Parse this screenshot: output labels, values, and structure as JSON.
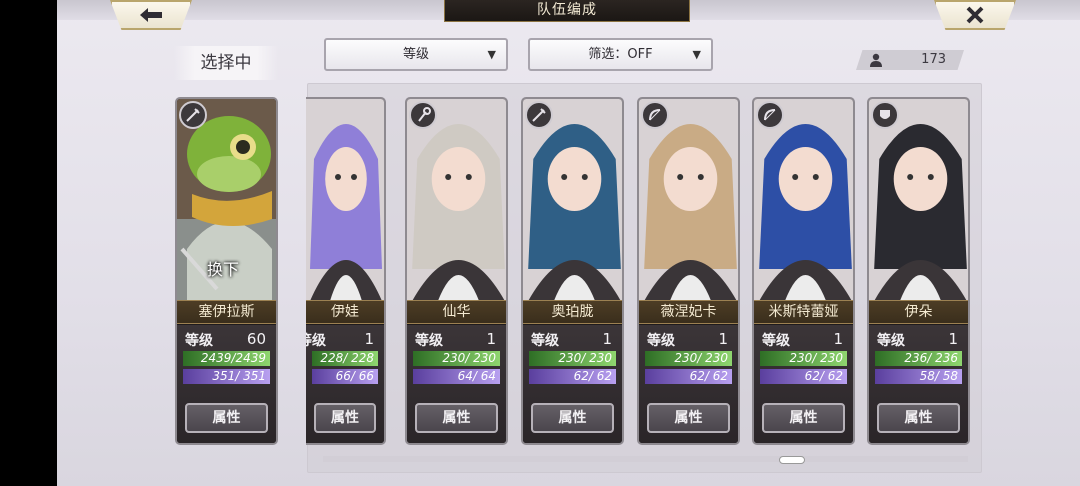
{
  "header": {
    "title": "队伍编成",
    "back_icon": "back-arrow-icon",
    "close_icon": "close-x-icon"
  },
  "selecting_label": "选择中",
  "filters": {
    "sort": {
      "value": "等级",
      "icon": "triangle-down-icon"
    },
    "filter": {
      "value": "筛选：OFF",
      "icon": "triangle-down-icon"
    }
  },
  "unit_count": {
    "value": "173",
    "icon": "user-icon"
  },
  "selected_card": {
    "name": "塞伊拉斯",
    "level_label": "等级",
    "level": "60",
    "hp": "2439/2439",
    "mp": "351/ 351",
    "attr": "属性",
    "swap_label": "换下",
    "role_icon": "sword-icon"
  },
  "roster": [
    {
      "name": "伊娃",
      "level_label": "等级",
      "level": "1",
      "hp": "228/ 228",
      "mp": "66/ 66",
      "attr": "属性",
      "role_icon": "staff-icon",
      "hair": "#8f7fd8"
    },
    {
      "name": "仙华",
      "level_label": "等级",
      "level": "1",
      "hp": "230/ 230",
      "mp": "64/ 64",
      "attr": "属性",
      "role_icon": "staff-icon",
      "hair": "#cfcac3"
    },
    {
      "name": "奥珀胧",
      "level_label": "等级",
      "level": "1",
      "hp": "230/ 230",
      "mp": "62/ 62",
      "attr": "属性",
      "role_icon": "sword-icon",
      "hair": "#2f5f86"
    },
    {
      "name": "薇涅妃卡",
      "level_label": "等级",
      "level": "1",
      "hp": "230/ 230",
      "mp": "62/ 62",
      "attr": "属性",
      "role_icon": "bow-icon",
      "hair": "#c9ab85"
    },
    {
      "name": "米斯特蕾娅",
      "level_label": "等级",
      "level": "1",
      "hp": "230/ 230",
      "mp": "62/ 62",
      "attr": "属性",
      "role_icon": "bow-icon",
      "hair": "#2d4fa6"
    },
    {
      "name": "伊朵",
      "level_label": "等级",
      "level": "1",
      "hp": "236/ 236",
      "mp": "58/ 58",
      "attr": "属性",
      "role_icon": "shield-icon",
      "hair": "#2a2a30"
    }
  ],
  "colors": {
    "hp_bar": "#8fd66f",
    "mp_bar": "#b8a0f0",
    "title_bg": "#1b1714",
    "accent_gold": "#b9a56c"
  }
}
